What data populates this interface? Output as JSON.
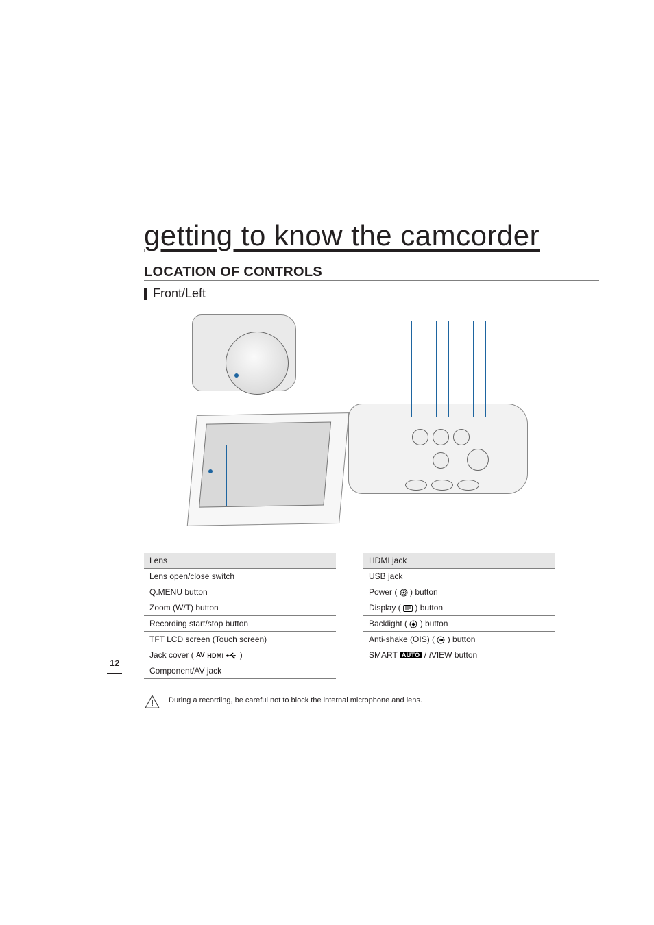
{
  "page_number": "12",
  "chapter_title": "getting to know the camcorder",
  "section_title": "LOCATION OF CONTROLS",
  "subsection_title": "Front/Left",
  "note_text": "During a recording, be careful not to block the internal microphone and lens.",
  "left_list": [
    "Lens",
    "Lens open/close switch",
    "Q.MENU button",
    "Zoom (W/T) button",
    "Recording start/stop button",
    "TFT LCD screen (Touch screen)",
    "Jack cover (",
    "Component/AV jack"
  ],
  "jack_cover_suffix": ")",
  "right_list": {
    "hdmi": "HDMI jack",
    "usb": "USB jack",
    "power_pre": "Power (",
    "power_post": ") button",
    "display_pre": "Display (",
    "display_post": ") button",
    "backlight_pre": "Backlight (",
    "backlight_post": ") button",
    "antishake_pre": "Anti-shake (OIS) (",
    "antishake_post": ") button",
    "smart_pre": "SMART ",
    "smart_auto": "AUTO",
    "smart_mid": " / ",
    "smart_i": "i",
    "smart_post": "VIEW button"
  },
  "jack_icons": {
    "av": "AV",
    "hdmi": "HDMI"
  }
}
